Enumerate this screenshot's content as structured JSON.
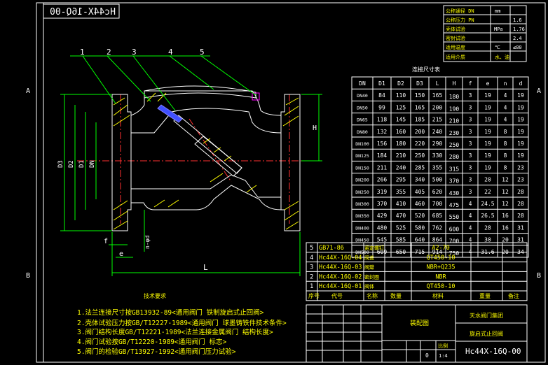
{
  "title_mirrored": "Hc44X-16Q-00",
  "zone_letters": {
    "a": "A",
    "b": "B"
  },
  "part_balloons": [
    "1",
    "2",
    "3",
    "4",
    "5"
  ],
  "dims": {
    "D3": "D3",
    "D2": "D2",
    "D1": "D1",
    "DN": "DN",
    "H": "H",
    "L": "L",
    "f": "f",
    "e": "e",
    "nd": "n-φd"
  },
  "param_table": {
    "rows": [
      {
        "label": "公称通径 DN",
        "unit": "mm",
        "value": ""
      },
      {
        "label": "公称压力 PN",
        "unit": "",
        "value": "1.6"
      },
      {
        "label": "壳体试验",
        "unit": "MPa",
        "value": "1.76"
      },
      {
        "label": "密封试验",
        "unit": "",
        "value": "2.4"
      },
      {
        "label": "适用温度",
        "unit": "℃",
        "value": "≤80"
      },
      {
        "label": "适用介质",
        "unit": "",
        "value": "水、油"
      }
    ]
  },
  "dim_table": {
    "caption": "连接尺寸表",
    "headers": [
      "DN",
      "D1",
      "D2",
      "D3",
      "L",
      "H",
      "f",
      "e",
      "n",
      "d"
    ],
    "rows": [
      [
        "DN40",
        "84",
        "110",
        "150",
        "165",
        "180",
        "3",
        "19",
        "4",
        "19"
      ],
      [
        "DN50",
        "99",
        "125",
        "165",
        "200",
        "190",
        "3",
        "19",
        "4",
        "19"
      ],
      [
        "DN65",
        "118",
        "145",
        "185",
        "215",
        "210",
        "3",
        "19",
        "4",
        "19"
      ],
      [
        "DN80",
        "132",
        "160",
        "200",
        "240",
        "230",
        "3",
        "19",
        "8",
        "19"
      ],
      [
        "DN100",
        "156",
        "180",
        "220",
        "290",
        "250",
        "3",
        "19",
        "8",
        "19"
      ],
      [
        "DN125",
        "184",
        "210",
        "250",
        "330",
        "280",
        "3",
        "19",
        "8",
        "19"
      ],
      [
        "DN150",
        "211",
        "240",
        "285",
        "355",
        "315",
        "3",
        "19",
        "8",
        "23"
      ],
      [
        "DN200",
        "266",
        "295",
        "340",
        "500",
        "370",
        "3",
        "20",
        "12",
        "23"
      ],
      [
        "DN250",
        "319",
        "355",
        "405",
        "620",
        "430",
        "3",
        "22",
        "12",
        "28"
      ],
      [
        "DN300",
        "370",
        "410",
        "460",
        "700",
        "475",
        "4",
        "24.5",
        "12",
        "28"
      ],
      [
        "DN350",
        "429",
        "470",
        "520",
        "685",
        "550",
        "4",
        "26.5",
        "16",
        "28"
      ],
      [
        "DN400",
        "480",
        "525",
        "580",
        "762",
        "600",
        "4",
        "28",
        "16",
        "31"
      ],
      [
        "DN450",
        "545",
        "585",
        "640",
        "864",
        "700",
        "4",
        "30",
        "20",
        "31"
      ],
      [
        "DN500",
        "609",
        "650",
        "715",
        "914",
        "750",
        "4",
        "31.6",
        "20",
        "34"
      ]
    ]
  },
  "parts_list": [
    {
      "no": "5",
      "code": "GB71-86",
      "name": "紧定螺钉",
      "material": "A2-70"
    },
    {
      "no": "4",
      "code": "Hc44X-16Q-04",
      "name": "阀盖",
      "material": "QT450-10"
    },
    {
      "no": "3",
      "code": "Hc44X-16Q-03",
      "name": "阀瓣",
      "material": "NBR+Q235"
    },
    {
      "no": "2",
      "code": "Hc44X-16Q-02",
      "name": "密封圈",
      "material": "NBR"
    },
    {
      "no": "1",
      "code": "Hc44X-16Q-01",
      "name": "阀体",
      "material": "QT450-10"
    }
  ],
  "parts_header": {
    "no": "序号",
    "code": "代号",
    "name": "名称",
    "qty": "数量",
    "material": "材料",
    "weight": "重量",
    "note": "备注"
  },
  "notes": {
    "title": "技术要求",
    "items": [
      "1.法兰连接尺寸按GB13932-89<通用阀门 铁制旋启式止回阀>",
      "2.壳体试验压力按GB/T12227-1989<通用阀门 球墨铸铁件技术条件>",
      "3.阀门结构长度GB/T12221-1989<法兰连接金属阀门 结构长度>",
      "4.阀门试验按GB/T12220-1989<通用阀门 标志>",
      "5.阀门的检验GB/T13927-1992<通用阀门压力试验>"
    ]
  },
  "title_block": {
    "drawing_name": "装配图",
    "company": "天水阀门集团",
    "product": "旋启式止回阀",
    "drawing_no": "Hc44X-16Q-00",
    "scale_label": "比例",
    "scale": "1:4",
    "sheet": "0"
  },
  "colors": {
    "background": "#000000",
    "outline": "#ffffff",
    "text": "#ffff00",
    "leader": "#00ff00",
    "center": "#ff3030",
    "hatch": "#ffff00"
  }
}
